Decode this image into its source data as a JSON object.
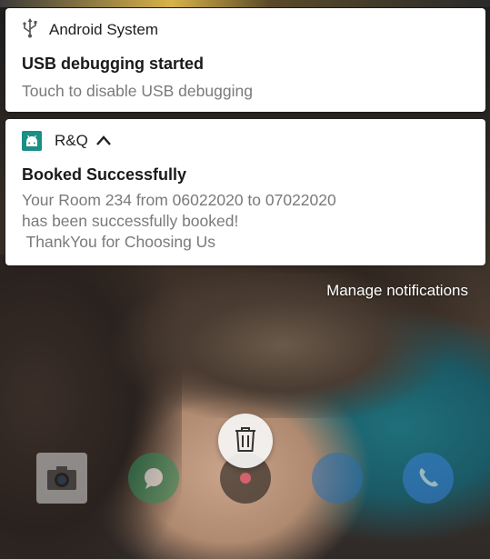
{
  "notifications": [
    {
      "app_name": "Android System",
      "title": "USB debugging started",
      "text": "Touch to disable USB debugging",
      "icon": "usb-icon"
    },
    {
      "app_name": "R&Q",
      "title": "Booked Successfully",
      "text": "Your Room 234 from 06022020 to 07022020\nhas been successfully booked!\n ThankYou for Choosing Us",
      "icon": "android-icon",
      "expanded": true,
      "accent_color": "#1a8f85"
    }
  ],
  "manage_notifications_label": "Manage notifications",
  "dock_icons": [
    "camera-icon",
    "messages-icon",
    "music-icon",
    "browser-icon",
    "phone-icon"
  ],
  "clear_all_icon": "trash-icon"
}
